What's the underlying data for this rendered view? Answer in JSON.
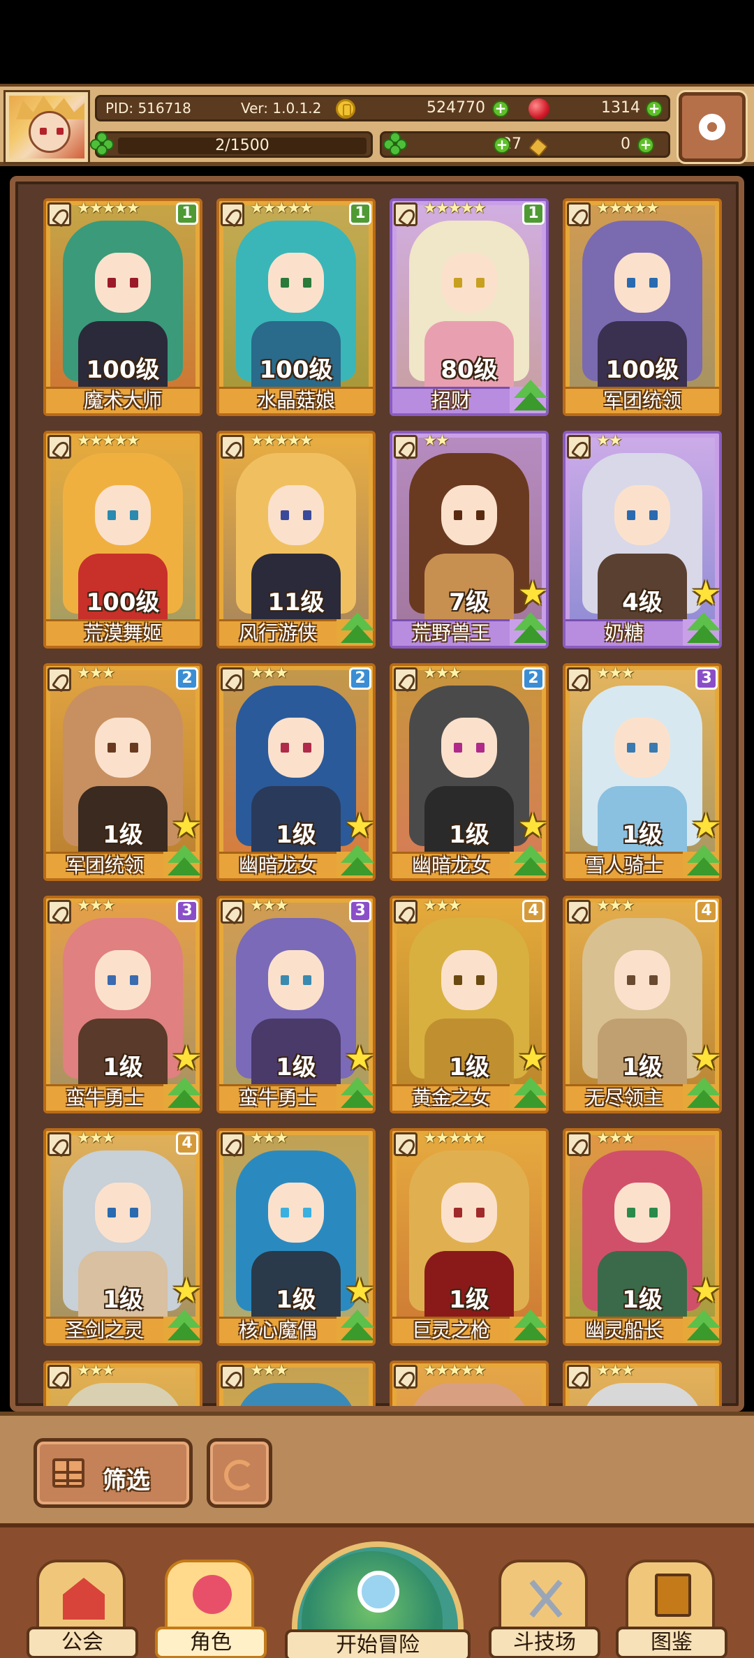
{
  "header": {
    "pid": "PID: 516718",
    "version": "Ver: 1.0.1.2",
    "gold": "524770",
    "rubies": "1314",
    "exp": "2/1500",
    "clovers": "27",
    "potions": "0"
  },
  "roster": [
    {
      "name": "魔术大师",
      "level": "100级",
      "stars": "★★★★★",
      "rank": "1",
      "frame": "orange",
      "upgrade": false,
      "star_badge": false
    },
    {
      "name": "水晶菇娘",
      "level": "100级",
      "stars": "★★★★★",
      "rank": "1",
      "frame": "orange",
      "upgrade": false,
      "star_badge": false
    },
    {
      "name": "招财",
      "level": "80级",
      "stars": "★★★★★",
      "rank": "1",
      "frame": "purple",
      "upgrade": true,
      "star_badge": false
    },
    {
      "name": "军团统领",
      "level": "100级",
      "stars": "★★★★★",
      "rank": "",
      "frame": "orange",
      "upgrade": false,
      "star_badge": false
    },
    {
      "name": "荒漠舞姬",
      "level": "100级",
      "stars": "★★★★★",
      "rank": "",
      "frame": "orange",
      "upgrade": false,
      "star_badge": false
    },
    {
      "name": "风行游侠",
      "level": "11级",
      "stars": "★★★★★",
      "rank": "",
      "frame": "orange",
      "upgrade": true,
      "star_badge": false
    },
    {
      "name": "荒野兽王",
      "level": "7级",
      "stars": "★★",
      "rank": "",
      "frame": "purple",
      "upgrade": true,
      "star_badge": true
    },
    {
      "name": "奶糖",
      "level": "4级",
      "stars": "★★",
      "rank": "",
      "frame": "purple",
      "upgrade": true,
      "star_badge": true
    },
    {
      "name": "军团统领",
      "level": "1级",
      "stars": "★★★",
      "rank": "2",
      "frame": "orange",
      "upgrade": true,
      "star_badge": true
    },
    {
      "name": "幽暗龙女",
      "level": "1级",
      "stars": "★★★",
      "rank": "2",
      "frame": "orange",
      "upgrade": true,
      "star_badge": true
    },
    {
      "name": "幽暗龙女",
      "level": "1级",
      "stars": "★★★",
      "rank": "2",
      "frame": "orange",
      "upgrade": true,
      "star_badge": true
    },
    {
      "name": "雪人骑士",
      "level": "1级",
      "stars": "★★★",
      "rank": "3",
      "frame": "orange",
      "upgrade": true,
      "star_badge": true
    },
    {
      "name": "蛮牛勇士",
      "level": "1级",
      "stars": "★★★",
      "rank": "3",
      "frame": "orange",
      "upgrade": true,
      "star_badge": true
    },
    {
      "name": "蛮牛勇士",
      "level": "1级",
      "stars": "★★★",
      "rank": "3",
      "frame": "orange",
      "upgrade": true,
      "star_badge": true
    },
    {
      "name": "黄金之女",
      "level": "1级",
      "stars": "★★★",
      "rank": "4",
      "frame": "orange",
      "upgrade": true,
      "star_badge": true
    },
    {
      "name": "无尽领主",
      "level": "1级",
      "stars": "★★★",
      "rank": "4",
      "frame": "orange",
      "upgrade": true,
      "star_badge": true
    },
    {
      "name": "圣剑之灵",
      "level": "1级",
      "stars": "★★★",
      "rank": "4",
      "frame": "orange",
      "upgrade": true,
      "star_badge": true
    },
    {
      "name": "核心魔偶",
      "level": "1级",
      "stars": "★★★",
      "rank": "",
      "frame": "orange",
      "upgrade": true,
      "star_badge": true
    },
    {
      "name": "巨灵之枪",
      "level": "1级",
      "stars": "★★★★★",
      "rank": "",
      "frame": "orange",
      "upgrade": true,
      "star_badge": false
    },
    {
      "name": "幽灵船长",
      "level": "1级",
      "stars": "★★★",
      "rank": "",
      "frame": "orange",
      "upgrade": true,
      "star_badge": true
    },
    {
      "name": "",
      "level": "",
      "stars": "★★★",
      "rank": "",
      "frame": "orange",
      "upgrade": false,
      "star_badge": false
    },
    {
      "name": "",
      "level": "",
      "stars": "★★★",
      "rank": "",
      "frame": "orange",
      "upgrade": false,
      "star_badge": false
    },
    {
      "name": "",
      "level": "",
      "stars": "★★★★★",
      "rank": "",
      "frame": "orange",
      "upgrade": false,
      "star_badge": false
    },
    {
      "name": "",
      "level": "",
      "stars": "★★★",
      "rank": "",
      "frame": "orange",
      "upgrade": false,
      "star_badge": false
    }
  ],
  "toolbar": {
    "filter_label": "筛选"
  },
  "nav": {
    "guild": "公会",
    "role": "角色",
    "adventure": "开始冒险",
    "arena": "斗技场",
    "codex": "图鉴"
  },
  "icons": {
    "settings": "gear-icon",
    "filter": "grid-icon",
    "refresh": "refresh-icon"
  }
}
